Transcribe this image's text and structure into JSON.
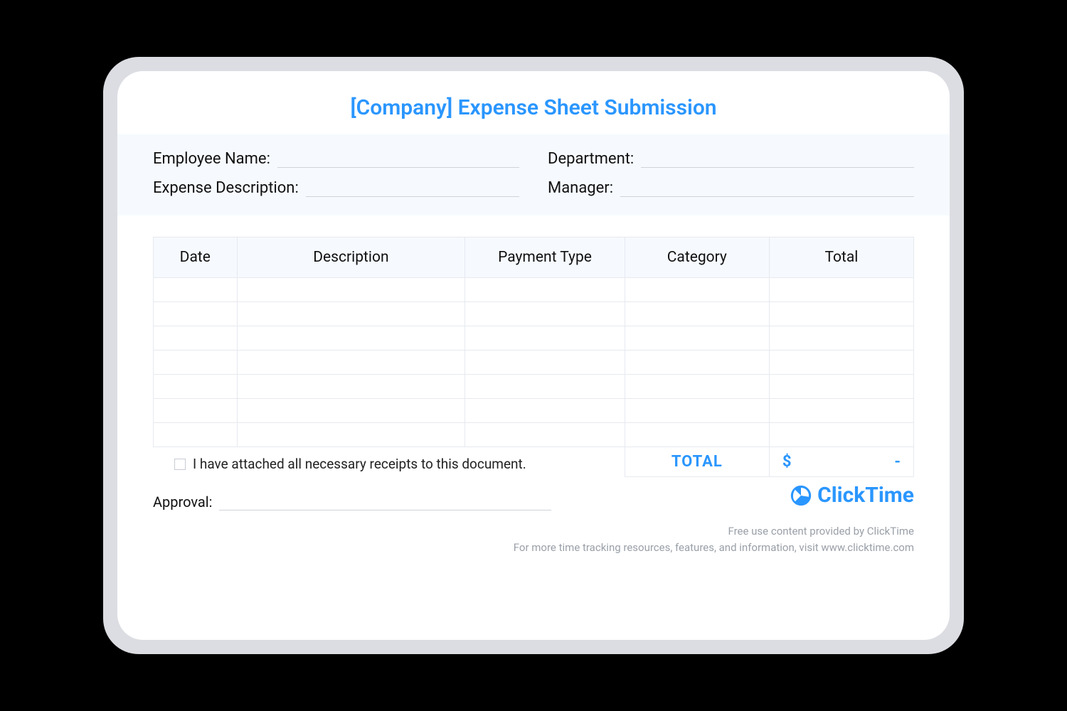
{
  "title": "[Company] Expense Sheet Submission",
  "fields": {
    "employee_name": "Employee Name:",
    "expense_description": "Expense Description:",
    "department": "Department:",
    "manager": "Manager:"
  },
  "columns": {
    "date": "Date",
    "description": "Description",
    "payment_type": "Payment Type",
    "category": "Category",
    "total": "Total"
  },
  "summary": {
    "label": "TOTAL",
    "currency": "$",
    "value": "-"
  },
  "receipt_text": "I have attached all necessary receipts to this document.",
  "approval_label": "Approval:",
  "brand_name": "ClickTime",
  "footer_line1": "Free use content provided by ClickTime",
  "footer_line2": "For more time tracking resources, features, and information, visit www.clicktime.com"
}
